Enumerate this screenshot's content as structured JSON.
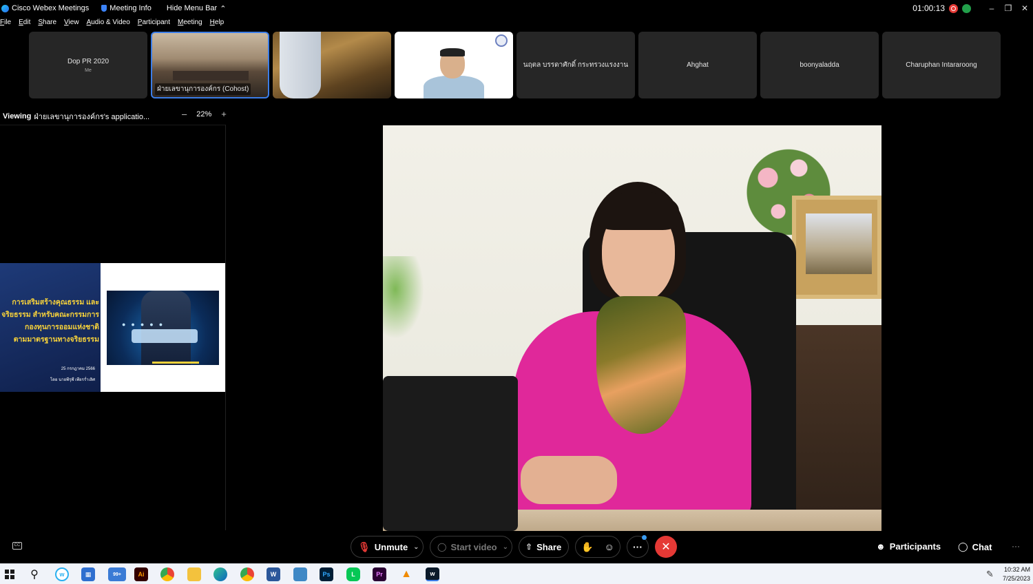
{
  "titlebar": {
    "app_name": "Cisco Webex Meetings",
    "meeting_info": "Meeting Info",
    "hide_menu_bar": "Hide Menu Bar",
    "timer": "01:00:13"
  },
  "menu": [
    "File",
    "Edit",
    "Share",
    "View",
    "Audio & Video",
    "Participant",
    "Meeting",
    "Help"
  ],
  "thumbnails": [
    {
      "name": "Dop PR 2020",
      "sub": "Me"
    },
    {
      "name": "ฝ่ายเลขานุการองค์กร (Cohost)"
    },
    {
      "name": ""
    },
    {
      "name": ""
    },
    {
      "name": "นฤตล บรรดาศักดิ์ กระทรวงแรงงาน"
    },
    {
      "name": "Ahghat"
    },
    {
      "name": "boonyaladda"
    },
    {
      "name": "Charuphan Intararoong"
    }
  ],
  "viewing": {
    "prefix": "Viewing",
    "text": "ฝ่ายเลขานุการองค์กร's applicatio...",
    "zoom": "22%"
  },
  "slide": {
    "title_line1": "การเสริมสร้างคุณธรรม และ",
    "title_line2": "จริยธรรม สำหรับคณะกรรมการ",
    "title_line3": "กองทุนการออมแห่งชาติ",
    "title_line4": "ตามมาตรฐานทางจริยธรรม",
    "date": "25 กรกฎาคม 2566",
    "by": "โดย นายพีรุฬ์ เพียรร่ำเลิศ"
  },
  "controls": {
    "unmute": "Unmute",
    "start_video": "Start video",
    "share": "Share",
    "participants": "Participants",
    "chat": "Chat",
    "more": "···"
  },
  "taskbar": {
    "time": "10:32 AM",
    "date": "7/25/2023",
    "badge": "99+"
  },
  "colors": {
    "accent": "#3b7de8",
    "end_call": "#e53935",
    "record": "#e53935",
    "network": "#22a04b",
    "slide_title": "#f7d23a"
  }
}
